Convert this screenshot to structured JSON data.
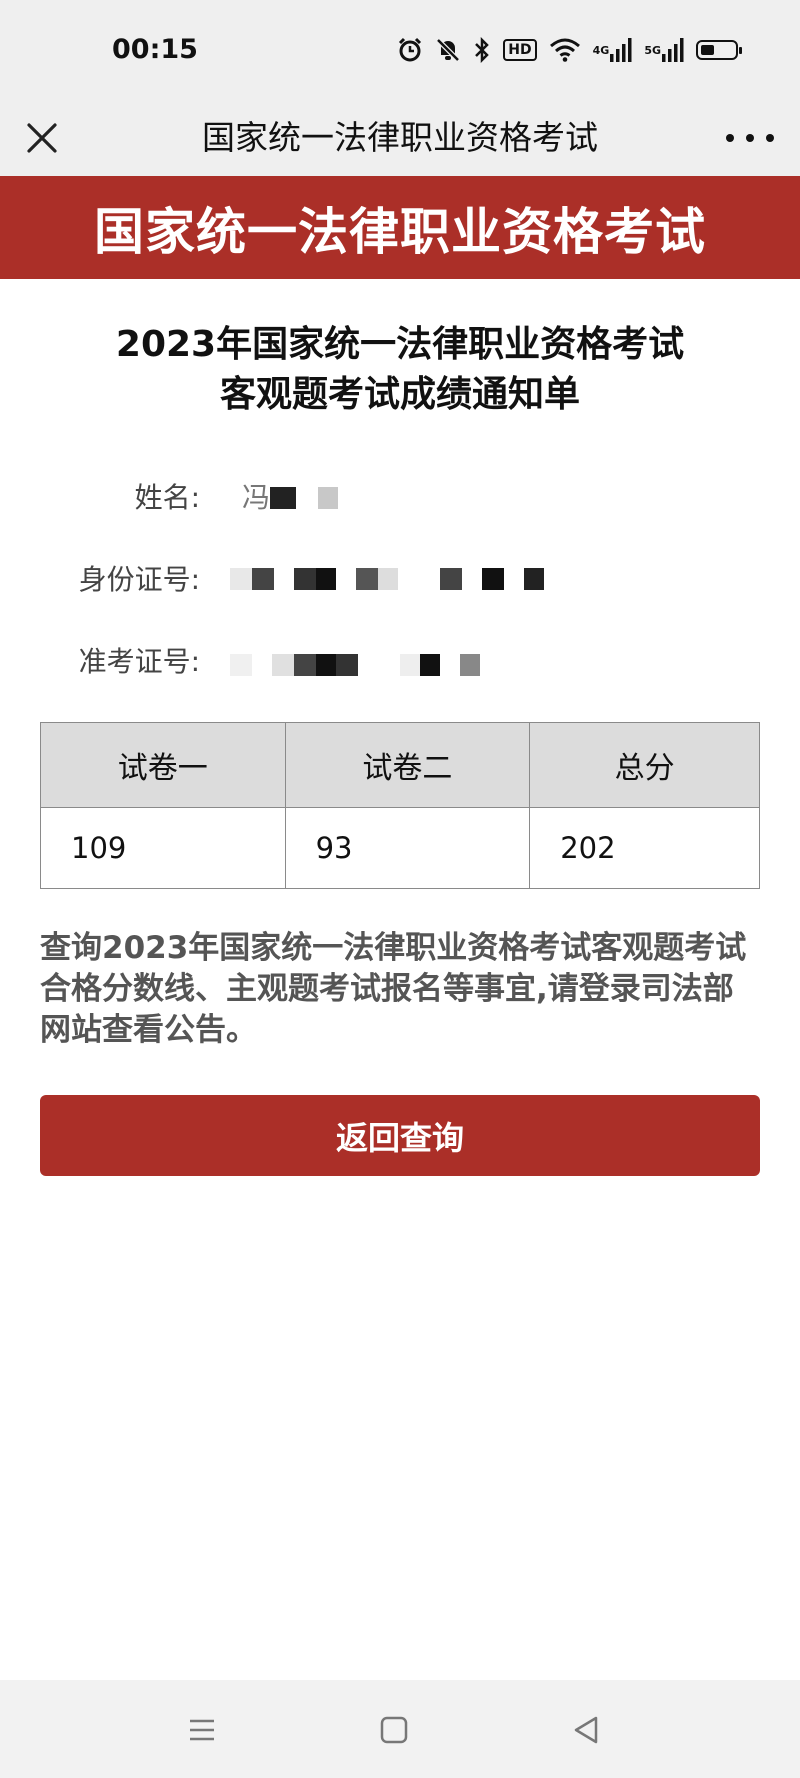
{
  "status_bar": {
    "time": "00:15",
    "icons": [
      "alarm-icon",
      "mute-icon",
      "bluetooth-icon",
      "hd-icon",
      "wifi-icon",
      "signal-4g-icon",
      "signal-5g-icon",
      "battery-icon"
    ],
    "hd_label": "HD",
    "net_4g": "4G",
    "net_5g": "5G",
    "battery_level": 0.4
  },
  "nav_bar": {
    "title": "国家统一法律职业资格考试",
    "close_icon": "close-icon",
    "more_icon": "more-icon"
  },
  "banner": {
    "title": "国家统一法律职业资格考试"
  },
  "notice": {
    "title_line1": "2023年国家统一法律职业资格考试",
    "title_line2": "客观题考试成绩通知单"
  },
  "info": {
    "name_label": "姓名:",
    "name_value_visible": "冯",
    "id_label": "身份证号:",
    "ticket_label": "准考证号:"
  },
  "scores": {
    "headers": [
      "试卷一",
      "试卷二",
      "总分"
    ],
    "values": [
      "109",
      "93",
      "202"
    ]
  },
  "note": {
    "text": "查询2023年国家统一法律职业资格考试客观题考试合格分数线、主观题考试报名等事宜,请登录司法部网站查看公告。"
  },
  "back_button": {
    "label": "返回查询"
  },
  "colors": {
    "brand_red": "#ab2f28",
    "table_header_bg": "#dcdcdc",
    "bar_bg": "#efefef"
  }
}
